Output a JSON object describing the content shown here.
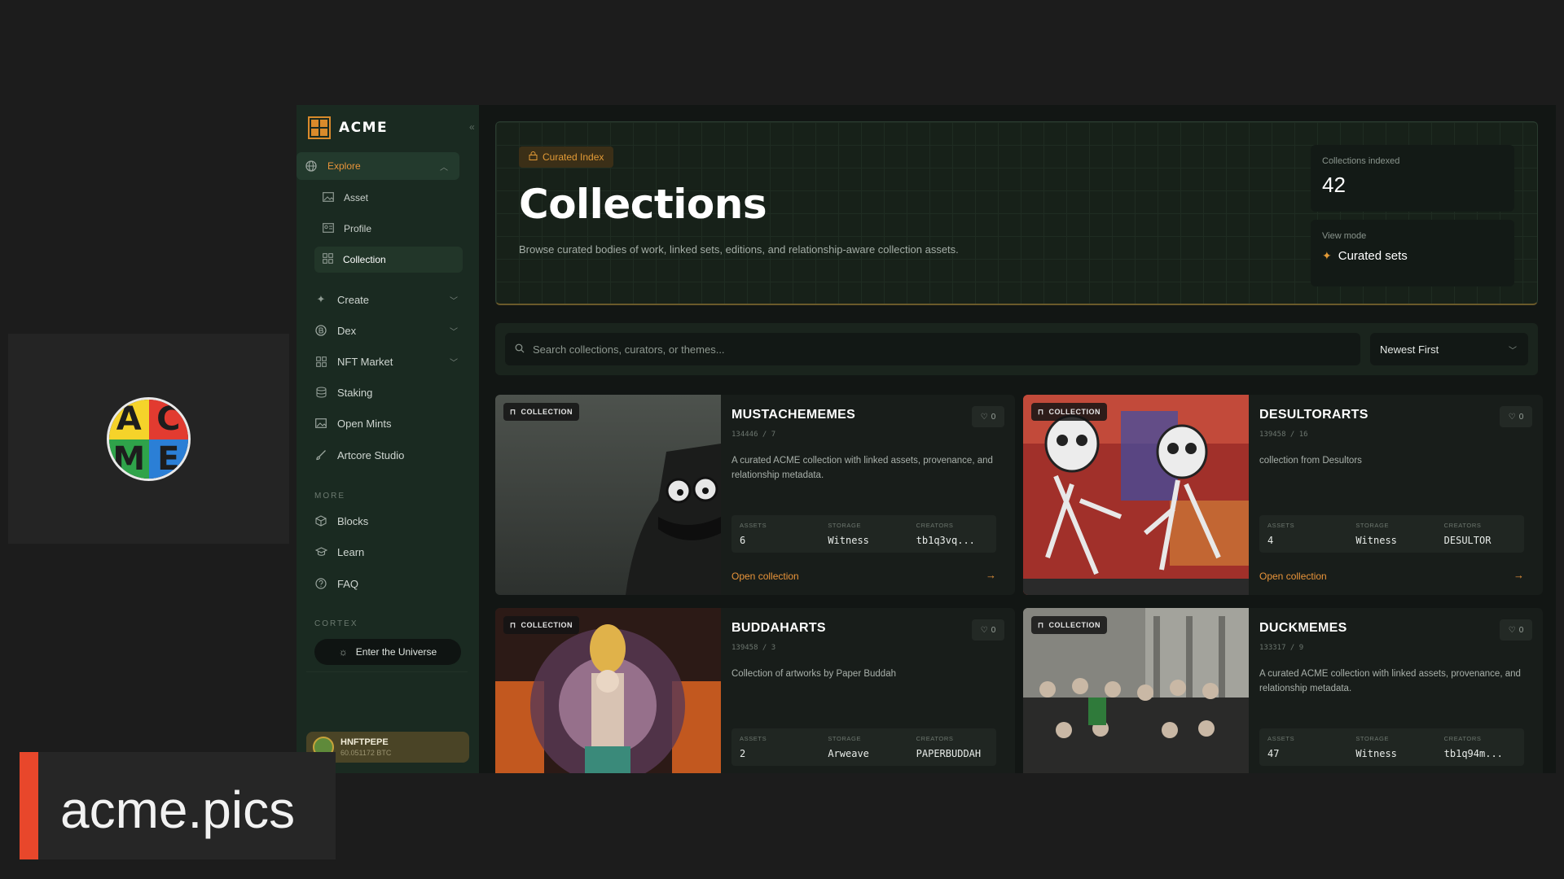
{
  "brand": {
    "name": "ACME",
    "circle_logo_letters": [
      "A",
      "C",
      "M",
      "E"
    ]
  },
  "sidebar": {
    "explore": {
      "label": "Explore",
      "items": [
        {
          "label": "Asset",
          "icon": "image-icon"
        },
        {
          "label": "Profile",
          "icon": "id-card-icon"
        },
        {
          "label": "Collection",
          "icon": "grid-icon"
        }
      ]
    },
    "main_items": [
      {
        "label": "Create",
        "icon": "sparkle-icon",
        "expandable": true
      },
      {
        "label": "Dex",
        "icon": "coin-icon",
        "expandable": true
      },
      {
        "label": "NFT Market",
        "icon": "grid-icon",
        "expandable": true
      },
      {
        "label": "Staking",
        "icon": "database-icon",
        "expandable": false
      },
      {
        "label": "Open Mints",
        "icon": "image-icon",
        "expandable": false
      },
      {
        "label": "Artcore Studio",
        "icon": "brush-icon",
        "expandable": false
      }
    ],
    "more_section": "MORE",
    "more_items": [
      {
        "label": "Blocks",
        "icon": "cube-icon"
      },
      {
        "label": "Learn",
        "icon": "graduation-cap-icon"
      },
      {
        "label": "FAQ",
        "icon": "help-circle-icon"
      }
    ],
    "cortex_section": "CORTEX",
    "cortex_button": "Enter the Universe",
    "user": {
      "name": "HNFTPEPE",
      "balance": "60.051172 BTC"
    }
  },
  "hero": {
    "badge": "Curated Index",
    "title": "Collections",
    "description": "Browse curated bodies of work, linked sets, editions, and relationship-aware collection assets.",
    "stat_indexed_label": "Collections indexed",
    "stat_indexed_value": "42",
    "stat_mode_label": "View mode",
    "stat_mode_value": "Curated sets"
  },
  "search": {
    "placeholder": "Search collections, curators, or themes...",
    "sort": "Newest First"
  },
  "card_labels": {
    "tag": "COLLECTION",
    "assets": "ASSETS",
    "storage": "STORAGE",
    "creators": "CREATORS",
    "open": "Open collection"
  },
  "collections": [
    {
      "name": "MUSTACHEMEMES",
      "meta": "134446 / 7",
      "desc": "A curated ACME collection with linked assets, provenance, and relationship metadata.",
      "likes": "0",
      "assets": "6",
      "storage": "Witness",
      "creators": "tb1q3vq..."
    },
    {
      "name": "DESULTORARTS",
      "meta": "139458 / 16",
      "desc": "collection from Desultors",
      "likes": "0",
      "assets": "4",
      "storage": "Witness",
      "creators": "DESULTOR"
    },
    {
      "name": "BUDDAHARTS",
      "meta": "139458 / 3",
      "desc": "Collection of artworks by Paper Buddah",
      "likes": "0",
      "assets": "2",
      "storage": "Arweave",
      "creators": "PAPERBUDDAH"
    },
    {
      "name": "DUCKMEMES",
      "meta": "133317 / 9",
      "desc": "A curated ACME collection with linked assets, provenance, and relationship metadata.",
      "likes": "0",
      "assets": "47",
      "storage": "Witness",
      "creators": "tb1q94m..."
    }
  ],
  "caption": "acme.pics",
  "colors": {
    "accent": "#e8943a",
    "sidebar": "#1a2a21",
    "caption_bar": "#e8472b"
  }
}
